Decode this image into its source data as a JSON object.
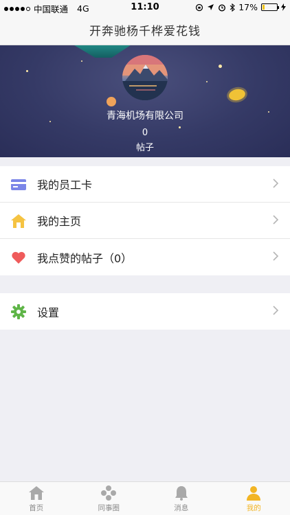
{
  "status_bar": {
    "carrier": "中国联通",
    "network": "4G",
    "time": "11:10",
    "battery_text": "17%",
    "battery_level": 0.17
  },
  "nav": {
    "title": "开奔驰杨千桦爱花钱"
  },
  "profile": {
    "company": "青海机场有限公司",
    "post_count": "0",
    "post_label": "帖子"
  },
  "menu": {
    "employee_card": "我的员工卡",
    "homepage": "我的主页",
    "liked_posts": "我点赞的帖子（0）",
    "settings": "设置"
  },
  "tabs": [
    {
      "label": "首页",
      "icon": "home-icon"
    },
    {
      "label": "同事圈",
      "icon": "colleague-circle-icon"
    },
    {
      "label": "消息",
      "icon": "bell-icon"
    },
    {
      "label": "我的",
      "icon": "person-icon",
      "active": true
    }
  ],
  "colors": {
    "accent": "#f2b524",
    "banner": "#353a66",
    "card_icon": "#7b86e8",
    "home_icon": "#f5c342",
    "heart_icon": "#ef5b5b",
    "settings_icon": "#5fb548"
  }
}
